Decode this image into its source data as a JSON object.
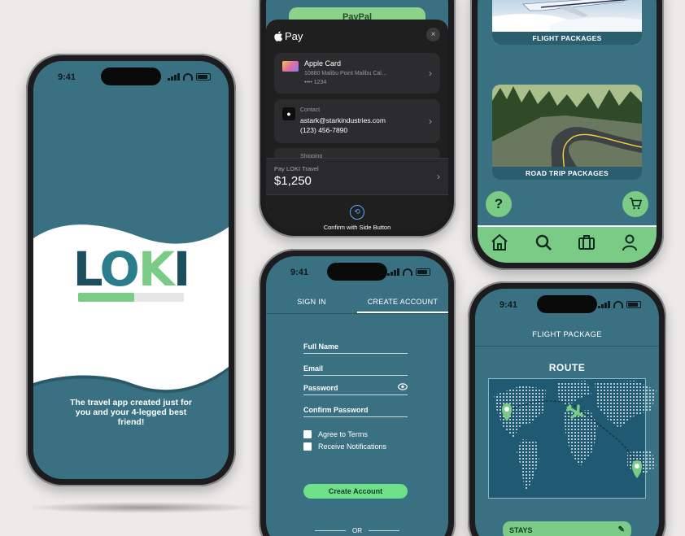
{
  "status": {
    "time": "9:41"
  },
  "splash": {
    "logo_letters": [
      "L",
      "O",
      "K",
      "I"
    ],
    "logo_colors": [
      "#1b4e5f",
      "#2b7c8c",
      "#7acb85",
      "#1b4e5f"
    ],
    "progress_fraction": 0.53,
    "tagline": "The travel app created just for you and your 4-legged best friend!"
  },
  "apple_pay": {
    "top_button": "PayPal",
    "brand": "Pay",
    "close": "×",
    "card_name": "Apple Card",
    "card_address": "10880 Malibu Point Malibu Cal…",
    "card_number": "•••• 1234",
    "contact_label": "Contact",
    "contact_email": "astark@starkindustries.com",
    "contact_phone": "(123) 456-7890",
    "ship_label": "Shipping",
    "pay_to": "Pay LOKI Travel",
    "amount": "$1,250",
    "confirm": "Confirm with Side Button"
  },
  "signup": {
    "tabs": [
      "SIGN IN",
      "CREATE ACCOUNT"
    ],
    "fields": [
      "Full Name",
      "Email",
      "Password",
      "Confirm Password"
    ],
    "checks": [
      "Agree to Terms",
      "Receive Notifications"
    ],
    "create_button": "Create Account",
    "or": "OR"
  },
  "packages": {
    "flight_label": "FLIGHT PACKAGES",
    "road_label": "ROAD TRIP PACKAGES",
    "help_button": "?",
    "nav": [
      "home-icon",
      "search-icon",
      "suitcase-icon",
      "profile-icon"
    ]
  },
  "flight_package": {
    "header": "FLIGHT PACKAGE",
    "route_title": "ROUTE",
    "stays_label": "STAYS",
    "pin_color": "#7acb85"
  }
}
